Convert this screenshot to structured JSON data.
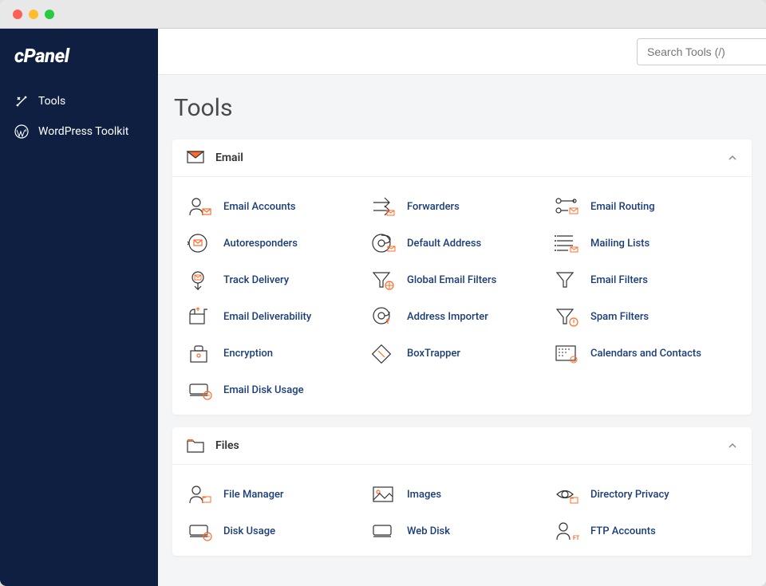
{
  "logo": "cPanel",
  "sidebar": {
    "items": [
      {
        "label": "Tools",
        "icon": "tools-icon"
      },
      {
        "label": "WordPress Toolkit",
        "icon": "wordpress-icon"
      }
    ]
  },
  "search": {
    "placeholder": "Search Tools (/)"
  },
  "page_title": "Tools",
  "sections": [
    {
      "title": "Email",
      "icon": "email-section-icon",
      "items": [
        {
          "label": "Email Accounts",
          "icon": "email-accounts-icon"
        },
        {
          "label": "Forwarders",
          "icon": "forwarders-icon"
        },
        {
          "label": "Email Routing",
          "icon": "email-routing-icon"
        },
        {
          "label": "Autoresponders",
          "icon": "autoresponders-icon"
        },
        {
          "label": "Default Address",
          "icon": "default-address-icon"
        },
        {
          "label": "Mailing Lists",
          "icon": "mailing-lists-icon"
        },
        {
          "label": "Track Delivery",
          "icon": "track-delivery-icon"
        },
        {
          "label": "Global Email Filters",
          "icon": "global-filters-icon"
        },
        {
          "label": "Email Filters",
          "icon": "email-filters-icon"
        },
        {
          "label": "Email Deliverability",
          "icon": "email-deliverability-icon"
        },
        {
          "label": "Address Importer",
          "icon": "address-importer-icon"
        },
        {
          "label": "Spam Filters",
          "icon": "spam-filters-icon"
        },
        {
          "label": "Encryption",
          "icon": "encryption-icon"
        },
        {
          "label": "BoxTrapper",
          "icon": "boxtrapper-icon"
        },
        {
          "label": "Calendars and Contacts",
          "icon": "calendars-contacts-icon"
        },
        {
          "label": "Email Disk Usage",
          "icon": "email-disk-usage-icon"
        }
      ]
    },
    {
      "title": "Files",
      "icon": "files-section-icon",
      "items": [
        {
          "label": "File Manager",
          "icon": "file-manager-icon"
        },
        {
          "label": "Images",
          "icon": "images-icon"
        },
        {
          "label": "Directory Privacy",
          "icon": "directory-privacy-icon"
        },
        {
          "label": "Disk Usage",
          "icon": "disk-usage-icon"
        },
        {
          "label": "Web Disk",
          "icon": "web-disk-icon"
        },
        {
          "label": "FTP Accounts",
          "icon": "ftp-accounts-icon"
        }
      ]
    }
  ]
}
